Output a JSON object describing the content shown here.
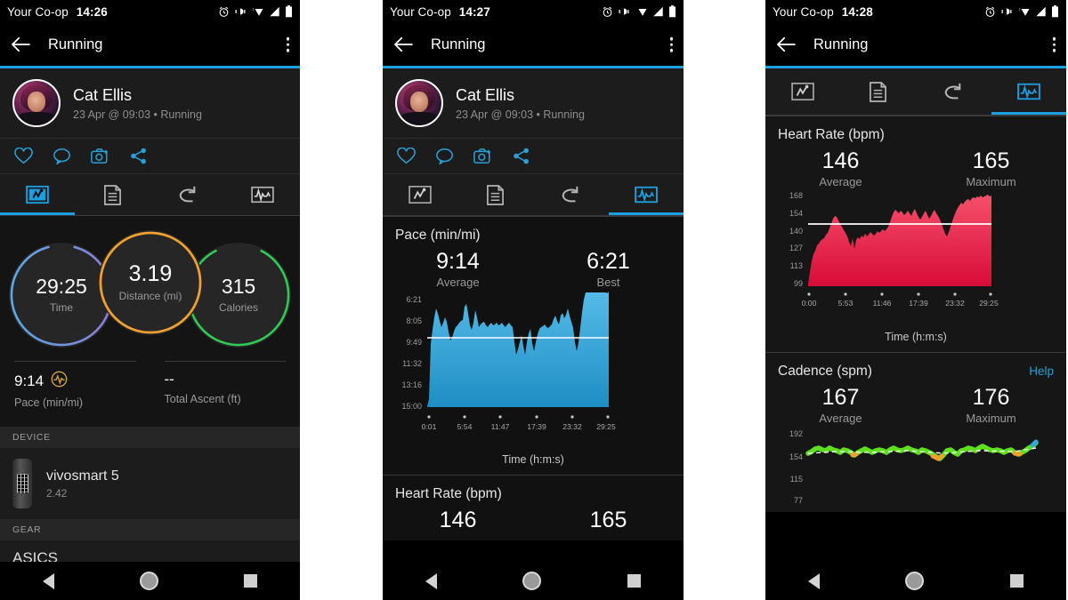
{
  "app": {
    "carrier": "Your Co-op",
    "title": "Running",
    "accent": "#1a9fe0"
  },
  "phones": [
    {
      "status_time": "14:26"
    },
    {
      "status_time": "14:27"
    },
    {
      "status_time": "14:28"
    }
  ],
  "profile": {
    "name": "Cat Ellis",
    "subtitle": "23 Apr @ 09:03 • Running"
  },
  "social_actions": [
    {
      "name": "like-icon",
      "label": "Like"
    },
    {
      "name": "comment-icon",
      "label": "Comment"
    },
    {
      "name": "photo-icon",
      "label": "Add photo"
    },
    {
      "name": "share-icon",
      "label": "Share"
    }
  ],
  "tabs": [
    {
      "name": "tab-summary",
      "icon": "activity-photo-icon"
    },
    {
      "name": "tab-details",
      "icon": "document-icon"
    },
    {
      "name": "tab-laps",
      "icon": "loop-icon"
    },
    {
      "name": "tab-charts",
      "icon": "waveform-icon"
    }
  ],
  "summary": {
    "rings": [
      {
        "value": "29:25",
        "label": "Time",
        "color": "#7b7fd4",
        "color2": "#5aa9e6"
      },
      {
        "value": "3.19",
        "label": "Distance (mi)",
        "color": "#f0a030",
        "color2": "#f0a030"
      },
      {
        "value": "315",
        "label": "Calories",
        "color": "#2ecc55",
        "color2": "#2ecc55"
      }
    ],
    "sub_stats": [
      {
        "value": "9:14",
        "caption": "Pace (min/mi)",
        "badge": "pace-badge-icon"
      },
      {
        "value": "--",
        "caption": "Total Ascent (ft)",
        "badge": ""
      }
    ],
    "device_section_label": "DEVICE",
    "device_name": "vivosmart 5",
    "device_version": "2.42",
    "gear_section_label": "GEAR",
    "gear_name": "ASICS"
  },
  "charts": {
    "pace": {
      "title": "Pace (min/mi)",
      "stats": [
        {
          "value": "9:14",
          "caption": "Average"
        },
        {
          "value": "6:21",
          "caption": "Best"
        }
      ],
      "x_axis_title": "Time (h:m:s)",
      "color": "#3ba9dd"
    },
    "heart_rate_small": {
      "title": "Heart Rate (bpm)",
      "stats": [
        {
          "value": "146",
          "caption": ""
        },
        {
          "value": "165",
          "caption": ""
        }
      ]
    },
    "heart_rate": {
      "title": "Heart Rate (bpm)",
      "stats": [
        {
          "value": "146",
          "caption": "Average"
        },
        {
          "value": "165",
          "caption": "Maximum"
        }
      ],
      "x_axis_title": "Time (h:m:s)",
      "color": "#e8294a"
    },
    "cadence": {
      "title": "Cadence (spm)",
      "help_label": "Help",
      "stats": [
        {
          "value": "167",
          "caption": "Average"
        },
        {
          "value": "176",
          "caption": "Maximum"
        }
      ],
      "color": "#5fe01f"
    }
  },
  "chart_data": [
    {
      "type": "area",
      "title": "Pace (min/mi)",
      "xlabel": "Time (h:m:s)",
      "ylabel": "Pace (min/mi)",
      "ytick_labels": [
        "6:21",
        "8:05",
        "9:49",
        "11:32",
        "13:16",
        "15:00"
      ],
      "ytick_values": [
        381,
        485,
        589,
        692,
        796,
        900
      ],
      "ylim": [
        381,
        900
      ],
      "y_inverted": true,
      "xtick_labels": [
        "0:01",
        "5:54",
        "11:47",
        "17:39",
        "23:32",
        "29:25"
      ],
      "xtick_values": [
        1,
        354,
        707,
        1059,
        1412,
        1765
      ],
      "xlim": [
        1,
        1765
      ],
      "average_line": 554,
      "average_label": "9:14",
      "best": "6:21",
      "grid": false,
      "legend": "none",
      "series_color": "#3ba9dd",
      "values_seconds_per_mile": [
        900,
        700,
        560,
        520,
        495,
        512,
        540,
        560,
        548,
        530,
        545,
        575,
        600,
        592,
        575,
        560,
        556,
        548,
        540,
        536,
        500,
        492,
        520,
        556,
        570,
        545,
        508,
        528,
        560,
        552,
        548,
        544,
        556,
        560,
        552,
        548,
        556,
        552,
        548,
        556,
        552,
        548,
        556,
        560,
        552,
        548,
        556,
        560,
        600,
        640,
        624,
        600,
        580,
        612,
        640,
        600,
        572,
        560,
        604,
        628,
        600,
        576,
        560,
        556,
        552,
        548,
        556,
        560,
        552,
        548,
        532,
        520,
        536,
        548,
        520,
        512,
        528,
        516,
        500,
        520,
        540,
        560,
        604,
        630,
        600,
        560,
        512,
        420,
        381
      ]
    },
    {
      "type": "area",
      "title": "Heart Rate (bpm)",
      "xlabel": "Time (h:m:s)",
      "ylabel": "Heart Rate (bpm)",
      "ytick_labels": [
        "168",
        "154",
        "140",
        "127",
        "113",
        "99"
      ],
      "ytick_values": [
        168,
        154,
        140,
        127,
        113,
        99
      ],
      "ylim": [
        99,
        168
      ],
      "xtick_labels": [
        "0:00",
        "5:53",
        "11:46",
        "17:39",
        "23:32",
        "29:25"
      ],
      "xtick_values": [
        0,
        353,
        706,
        1059,
        1412,
        1765
      ],
      "xlim": [
        0,
        1765
      ],
      "average_line": 146,
      "maximum": 165,
      "grid": false,
      "legend": "none",
      "series_color": "#e8294a",
      "values_bpm": [
        99,
        110,
        118,
        124,
        127,
        131,
        134,
        137,
        138,
        140,
        141,
        144,
        146,
        150,
        152,
        151,
        148,
        146,
        144,
        142,
        139,
        134,
        131,
        136,
        130,
        137,
        139,
        138,
        140,
        139,
        142,
        140,
        141,
        143,
        144,
        143,
        141,
        143,
        145,
        144,
        143,
        145,
        147,
        151,
        155,
        157,
        156,
        155,
        157,
        156,
        154,
        155,
        157,
        155,
        153,
        157,
        159,
        155,
        152,
        150,
        152,
        155,
        157,
        152,
        146,
        143,
        141,
        145,
        150,
        154,
        156,
        157,
        159,
        160,
        161,
        163,
        164,
        163,
        165,
        164,
        165
      ]
    },
    {
      "type": "line",
      "title": "Cadence (spm)",
      "ylabel": "Cadence (spm)",
      "ytick_labels": [
        "192",
        "154",
        "115",
        "77"
      ],
      "ytick_values": [
        192,
        154,
        115,
        77
      ],
      "ylim": [
        77,
        192
      ],
      "average_line": 167,
      "maximum": 176,
      "grid": false,
      "legend": "none",
      "series_color": "#5fe01f",
      "values_spm": [
        164,
        166,
        168,
        169,
        168,
        167,
        169,
        168,
        167,
        166,
        168,
        167,
        166,
        164,
        166,
        167,
        168,
        167,
        166,
        167,
        168,
        167,
        166,
        168,
        169,
        168,
        167,
        168,
        169,
        168,
        167,
        166,
        168,
        167,
        166,
        165,
        163,
        161,
        164,
        167,
        168,
        166,
        165,
        167,
        168,
        169,
        168,
        167,
        169,
        170,
        169,
        168,
        167,
        168,
        167,
        166,
        167,
        168,
        167,
        166,
        165,
        166,
        168,
        169,
        171,
        176
      ]
    }
  ]
}
